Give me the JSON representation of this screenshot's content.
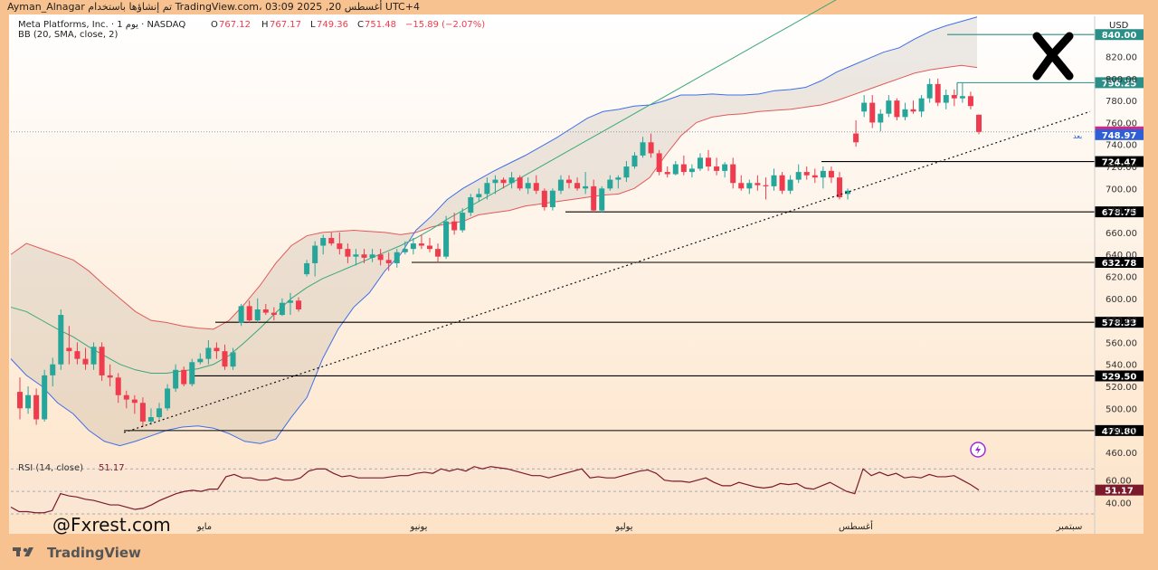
{
  "header": {
    "author": "Ayman_Alnagar",
    "published": "تم إنشاؤها باستخدام TradingView.com، 03:09 2025 ,20 أغسطس UTC+4"
  },
  "legend": {
    "symbol_line": "Meta Platforms, Inc. · يوم 1 · NASDAQ",
    "ohlc_o_label": "O",
    "ohlc_o": "767.12",
    "ohlc_h_label": "H",
    "ohlc_h": "767.17",
    "ohlc_l_label": "L",
    "ohlc_l": "749.36",
    "ohlc_c_label": "C",
    "ohlc_c": "751.48",
    "change": "−15.89 (−2.07%)",
    "indicator": "BB (20, SMA, close, 2)"
  },
  "currency": "USD",
  "watermark_text": "@Fxrest.com",
  "brand": "TradingView",
  "colors": {
    "bg_outer": "#f7c28f",
    "up": "#26a69a",
    "down": "#ef3b4d",
    "bb_upper": "#e05a5a",
    "bb_lower": "#3f6fe8",
    "bb_basis": "#3aa87a",
    "rsi_line": "#7b1a2a",
    "level": "#000000",
    "target": "#2a8f86"
  },
  "chart_data": {
    "type": "candlestick",
    "ylim": [
      455,
      855
    ],
    "y_ticks": [
      "460.00",
      "480.00",
      "500.00",
      "520.00",
      "540.00",
      "560.00",
      "580.00",
      "600.00",
      "620.00",
      "640.00",
      "660.00",
      "680.00",
      "700.00",
      "720.00",
      "740.00",
      "760.00",
      "780.00",
      "800.00",
      "820.00",
      "840.00"
    ],
    "x_labels": [
      "مايو",
      "يونيو",
      "يوليو",
      "أغسطس",
      "سبتمبر"
    ],
    "candles": [
      [
        515,
        528,
        490,
        500
      ],
      [
        500,
        520,
        495,
        512
      ],
      [
        512,
        518,
        485,
        490
      ],
      [
        490,
        535,
        488,
        530
      ],
      [
        530,
        546,
        520,
        540
      ],
      [
        540,
        590,
        535,
        585
      ],
      [
        555,
        575,
        540,
        552
      ],
      [
        552,
        560,
        540,
        545
      ],
      [
        545,
        555,
        535,
        540
      ],
      [
        540,
        560,
        535,
        556
      ],
      [
        556,
        560,
        525,
        530
      ],
      [
        530,
        540,
        520,
        528
      ],
      [
        528,
        532,
        505,
        512
      ],
      [
        512,
        516,
        500,
        508
      ],
      [
        508,
        512,
        495,
        505
      ],
      [
        505,
        510,
        483,
        488
      ],
      [
        488,
        500,
        485,
        492
      ],
      [
        492,
        505,
        490,
        500
      ],
      [
        500,
        522,
        498,
        518
      ],
      [
        518,
        540,
        515,
        535
      ],
      [
        535,
        538,
        520,
        522
      ],
      [
        522,
        545,
        520,
        542
      ],
      [
        542,
        550,
        540,
        545
      ],
      [
        545,
        562,
        540,
        555
      ],
      [
        555,
        560,
        545,
        552
      ],
      [
        552,
        558,
        535,
        538
      ],
      [
        538,
        555,
        535,
        551
      ],
      [
        578,
        595,
        575,
        593
      ],
      [
        593,
        598,
        578,
        580
      ],
      [
        580,
        600,
        578,
        590
      ],
      [
        590,
        595,
        585,
        587
      ],
      [
        587,
        592,
        580,
        585
      ],
      [
        585,
        600,
        584,
        596
      ],
      [
        596,
        605,
        585,
        598
      ],
      [
        598,
        601,
        588,
        590
      ],
      [
        622,
        635,
        620,
        632
      ],
      [
        632,
        652,
        620,
        648
      ],
      [
        648,
        658,
        640,
        655
      ],
      [
        655,
        660,
        648,
        650
      ],
      [
        650,
        660,
        640,
        645
      ],
      [
        645,
        650,
        632,
        638
      ],
      [
        638,
        645,
        630,
        640
      ],
      [
        640,
        645,
        632,
        637
      ],
      [
        637,
        645,
        633,
        640
      ],
      [
        640,
        645,
        630,
        635
      ],
      [
        635,
        642,
        625,
        632
      ],
      [
        632,
        645,
        628,
        642
      ],
      [
        642,
        652,
        640,
        645
      ],
      [
        645,
        655,
        640,
        650
      ],
      [
        650,
        658,
        645,
        648
      ],
      [
        648,
        655,
        642,
        645
      ],
      [
        645,
        650,
        632,
        638
      ],
      [
        638,
        675,
        636,
        670
      ],
      [
        670,
        678,
        658,
        662
      ],
      [
        662,
        682,
        660,
        678
      ],
      [
        678,
        695,
        675,
        692
      ],
      [
        692,
        700,
        688,
        695
      ],
      [
        695,
        710,
        690,
        705
      ],
      [
        705,
        712,
        695,
        708
      ],
      [
        708,
        710,
        700,
        705
      ],
      [
        705,
        715,
        700,
        710
      ],
      [
        710,
        712,
        698,
        700
      ],
      [
        700,
        710,
        695,
        705
      ],
      [
        705,
        712,
        695,
        698
      ],
      [
        698,
        700,
        680,
        683
      ],
      [
        683,
        700,
        680,
        698
      ],
      [
        698,
        712,
        695,
        708
      ],
      [
        708,
        712,
        700,
        705
      ],
      [
        705,
        710,
        698,
        700
      ],
      [
        700,
        715,
        695,
        702
      ],
      [
        702,
        708,
        678,
        680
      ],
      [
        680,
        702,
        678,
        700
      ],
      [
        700,
        712,
        698,
        708
      ],
      [
        708,
        712,
        700,
        710
      ],
      [
        710,
        725,
        706,
        720
      ],
      [
        720,
        733,
        718,
        730
      ],
      [
        730,
        747,
        728,
        742
      ],
      [
        742,
        750,
        728,
        732
      ],
      [
        732,
        735,
        712,
        715
      ],
      [
        715,
        720,
        710,
        713
      ],
      [
        713,
        725,
        712,
        722
      ],
      [
        722,
        730,
        712,
        715
      ],
      [
        715,
        722,
        710,
        718
      ],
      [
        718,
        732,
        716,
        728
      ],
      [
        728,
        735,
        716,
        720
      ],
      [
        720,
        728,
        712,
        716
      ],
      [
        716,
        724,
        710,
        722
      ],
      [
        722,
        728,
        700,
        705
      ],
      [
        705,
        712,
        698,
        700
      ],
      [
        700,
        708,
        695,
        705
      ],
      [
        705,
        712,
        698,
        703
      ],
      [
        703,
        710,
        690,
        702
      ],
      [
        702,
        718,
        698,
        712
      ],
      [
        712,
        715,
        695,
        698
      ],
      [
        698,
        712,
        695,
        708
      ],
      [
        708,
        722,
        705,
        715
      ],
      [
        715,
        720,
        708,
        712
      ],
      [
        712,
        718,
        705,
        710
      ],
      [
        710,
        720,
        700,
        716
      ],
      [
        716,
        720,
        705,
        710
      ],
      [
        710,
        715,
        690,
        692
      ],
      [
        695,
        700,
        690,
        698
      ],
      [
        750,
        762,
        738,
        742
      ],
      [
        770,
        785,
        765,
        778
      ],
      [
        778,
        785,
        755,
        760
      ],
      [
        760,
        772,
        752,
        768
      ],
      [
        768,
        785,
        765,
        780
      ],
      [
        780,
        782,
        762,
        765
      ],
      [
        765,
        778,
        762,
        772
      ],
      [
        772,
        780,
        768,
        770
      ],
      [
        770,
        785,
        765,
        782
      ],
      [
        782,
        800,
        778,
        795
      ],
      [
        795,
        800,
        775,
        778
      ],
      [
        778,
        790,
        772,
        785
      ],
      [
        785,
        790,
        775,
        782
      ],
      [
        782,
        796,
        778,
        784
      ],
      [
        784,
        788,
        772,
        775
      ],
      [
        767.12,
        767.17,
        749.36,
        751.48
      ]
    ],
    "bb_upper": [
      640,
      650,
      645,
      640,
      635,
      625,
      612,
      600,
      588,
      580,
      578,
      575,
      573,
      572,
      580,
      595,
      612,
      632,
      648,
      657,
      660,
      661,
      662,
      661,
      660,
      658,
      660,
      665,
      668,
      670,
      676,
      678,
      680,
      684,
      686,
      688,
      690,
      692,
      694,
      695,
      700,
      710,
      730,
      748,
      760,
      765,
      767,
      768,
      770,
      771,
      772,
      774,
      776,
      780,
      785,
      790,
      795,
      800,
      805,
      808,
      810,
      812,
      810
    ],
    "bb_lower": [
      545,
      530,
      520,
      505,
      495,
      480,
      470,
      466,
      470,
      475,
      480,
      483,
      484,
      482,
      477,
      470,
      468,
      472,
      492,
      510,
      545,
      572,
      592,
      605,
      625,
      640,
      662,
      675,
      690,
      700,
      708,
      716,
      723,
      730,
      738,
      746,
      755,
      764,
      770,
      772,
      775,
      776,
      780,
      785,
      785,
      786,
      785,
      785,
      786,
      789,
      790,
      792,
      798,
      806,
      812,
      818,
      824,
      828,
      836,
      843,
      848,
      852,
      856
    ],
    "bb_basis": [
      592,
      588,
      580,
      572,
      565,
      556,
      548,
      540,
      535,
      532,
      532,
      534,
      536,
      540,
      548,
      560,
      573,
      587,
      600,
      610,
      618,
      624,
      630,
      636,
      642,
      648,
      655,
      663,
      672,
      680,
      688,
      696,
      704,
      712,
      720,
      728,
      736,
      744,
      752,
      760,
      768,
      776,
      784,
      792,
      800,
      808,
      816,
      824,
      832,
      840,
      848,
      856,
      864,
      872,
      880,
      888,
      896,
      904,
      912,
      920,
      928,
      936,
      944
    ],
    "trendline_start": [
      137,
      478
    ],
    "trendline_end": [
      1205,
      770
    ],
    "levels": [
      {
        "label": "840.00",
        "value": 840,
        "kind": "target"
      },
      {
        "label": "796.25",
        "value": 796.25,
        "kind": "target"
      },
      {
        "label": "751.48",
        "value": 751.48,
        "kind": "last"
      },
      {
        "label": "748.97",
        "value": 748.97,
        "kind": "basis"
      },
      {
        "label": "724.47",
        "value": 724.47,
        "kind": "support"
      },
      {
        "label": "678.75",
        "value": 678.75,
        "kind": "support"
      },
      {
        "label": "632.78",
        "value": 632.78,
        "kind": "support"
      },
      {
        "label": "578.33",
        "value": 578.33,
        "kind": "support"
      },
      {
        "label": "529.50",
        "value": 529.5,
        "kind": "support"
      },
      {
        "label": "479.80",
        "value": 479.8,
        "kind": "support"
      }
    ],
    "rsi": {
      "label": "RSI (14, close)",
      "value": "51.17",
      "ticks": [
        "60.00",
        "40.00"
      ],
      "ylim": [
        30,
        75
      ],
      "values": [
        36,
        32,
        32,
        31,
        31,
        33,
        48,
        46,
        45,
        43,
        42,
        40,
        38,
        38,
        36,
        34,
        35,
        38,
        42,
        45,
        48,
        50,
        51,
        50,
        52,
        52,
        63,
        65,
        62,
        62,
        60,
        60,
        62,
        60,
        60,
        62,
        68,
        70,
        70,
        66,
        63,
        64,
        62,
        62,
        62,
        62,
        63,
        64,
        64,
        66,
        67,
        66,
        70,
        68,
        70,
        68,
        72,
        70,
        72,
        71,
        70,
        68,
        66,
        64,
        64,
        62,
        64,
        66,
        68,
        70,
        62,
        63,
        62,
        62,
        64,
        66,
        68,
        69,
        66,
        60,
        59,
        59,
        58,
        60,
        62,
        58,
        55,
        55,
        58,
        56,
        54,
        53,
        54,
        57,
        56,
        57,
        53,
        52,
        55,
        58,
        54,
        50,
        48,
        70,
        64,
        67,
        64,
        66,
        62,
        63,
        62,
        65,
        63,
        63,
        64,
        60,
        56,
        51.17
      ]
    },
    "up_label": "بعد"
  }
}
